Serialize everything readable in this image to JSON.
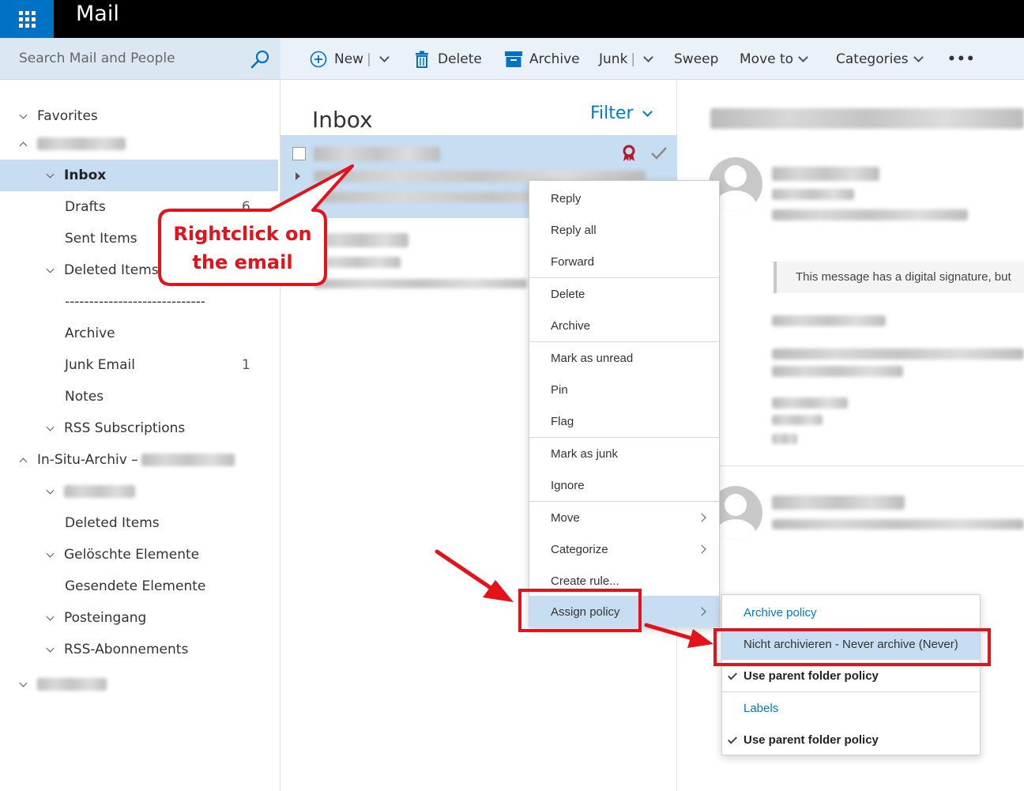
{
  "app": {
    "title": "Mail"
  },
  "search": {
    "placeholder": "Search Mail and People"
  },
  "toolbar": {
    "new_label": "New",
    "delete_label": "Delete",
    "archive_label": "Archive",
    "junk_label": "Junk",
    "sweep_label": "Sweep",
    "moveto_label": "Move to",
    "categories_label": "Categories",
    "more_label": "•••"
  },
  "folders": {
    "favorites": "Favorites",
    "inbox": "Inbox",
    "drafts": "Drafts",
    "drafts_count": "6",
    "sent": "Sent Items",
    "deleted": "Deleted Items",
    "separator": "-----------------------------",
    "archive": "Archive",
    "junk": "Junk Email",
    "junk_count": "1",
    "notes": "Notes",
    "rss": "RSS Subscriptions",
    "insitu": "In-Situ-Archiv –",
    "deleted2": "Deleted Items",
    "geloeschte": "Gelöschte Elemente",
    "gesendete": "Gesendete Elemente",
    "posteingang": "Posteingang",
    "rss2": "RSS-Abonnements"
  },
  "list": {
    "title": "Inbox",
    "filter_label": "Filter"
  },
  "reading": {
    "signature_notice": "This message has a digital signature, but"
  },
  "context_menu": {
    "reply": "Reply",
    "reply_all": "Reply all",
    "forward": "Forward",
    "delete": "Delete",
    "archive": "Archive",
    "mark_unread": "Mark as unread",
    "pin": "Pin",
    "flag": "Flag",
    "mark_junk": "Mark as junk",
    "ignore": "Ignore",
    "move": "Move",
    "categorize": "Categorize",
    "create_rule": "Create rule...",
    "assign_policy": "Assign policy"
  },
  "submenu": {
    "archive_policy_header": "Archive policy",
    "never_archive": "Nicht archivieren - Never archive (Never)",
    "use_parent_1": "Use parent folder policy",
    "labels_header": "Labels",
    "use_parent_2": "Use parent folder policy"
  },
  "annotation": {
    "line1": "Rightclick on",
    "line2": "the email"
  },
  "colors": {
    "accent": "#0072c6",
    "selection": "#c7ddf1",
    "annotation_red": "#e3121b"
  }
}
